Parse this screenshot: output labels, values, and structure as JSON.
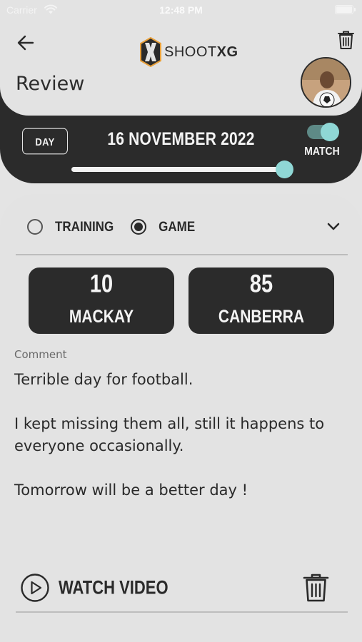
{
  "status_bar": {
    "carrier": "Carrier",
    "time": "12:48 PM"
  },
  "header": {
    "logo_text_light": "SHOOT",
    "logo_text_bold": "XG",
    "title": "Review"
  },
  "filter_bar": {
    "period_button": "DAY",
    "date": "16 NOVEMBER 2022",
    "match_toggle_label": "MATCH",
    "match_toggle_on": true,
    "slider_value": 1.0
  },
  "session_type": {
    "options": [
      {
        "label": "TRAINING",
        "selected": false
      },
      {
        "label": "GAME",
        "selected": true
      }
    ]
  },
  "scores": [
    {
      "value": "10",
      "team": "MACKAY"
    },
    {
      "value": "85",
      "team": "CANBERRA"
    }
  ],
  "comment": {
    "label": "Comment",
    "text": "Terrible day for football.\n\nI kept missing them all, still it happens to everyone occasionally.\n\nTomorrow will be a better day !"
  },
  "actions": {
    "watch_video": "WATCH VIDEO"
  },
  "colors": {
    "dark": "#2b2b2b",
    "accent": "#8fd7d5",
    "background": "#e3e3e3"
  }
}
